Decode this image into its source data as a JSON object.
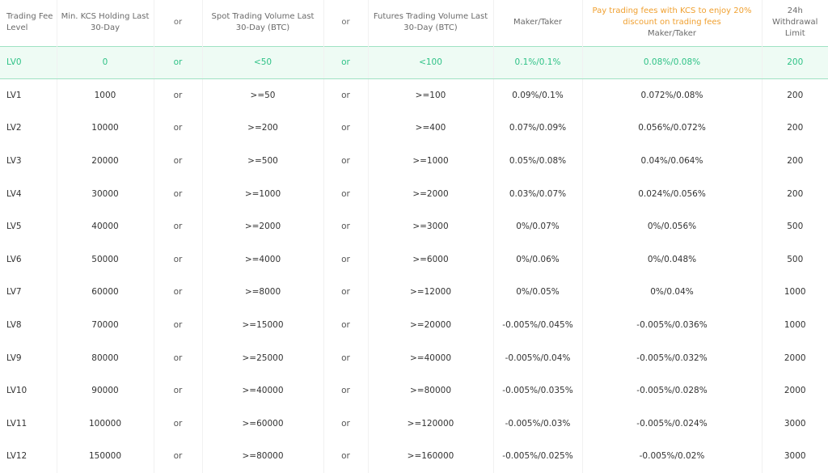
{
  "headers": {
    "level": "Trading Fee Level",
    "kcs_holding": "Min. KCS Holding Last 30-Day",
    "or1": "or",
    "spot_volume": "Spot Trading Volume Last 30-Day (BTC)",
    "or2": "or",
    "futures_volume": "Futures Trading Volume Last 30-Day (BTC)",
    "maker_taker": "Maker/Taker",
    "kcs_promo": "Pay trading fees with KCS to enjoy 20% discount on trading fees",
    "kcs_maker_taker": "Maker/Taker",
    "withdrawal": "24h Withdrawal Limit"
  },
  "rows": [
    {
      "level": "LV0",
      "kcs": "0",
      "or1": "or",
      "spot": "<50",
      "or2": "or",
      "futures": "<100",
      "fee": "0.1%/0.1%",
      "kcs_fee": "0.08%/0.08%",
      "limit": "200"
    },
    {
      "level": "LV1",
      "kcs": "1000",
      "or1": "or",
      "spot": ">=50",
      "or2": "or",
      "futures": ">=100",
      "fee": "0.09%/0.1%",
      "kcs_fee": "0.072%/0.08%",
      "limit": "200"
    },
    {
      "level": "LV2",
      "kcs": "10000",
      "or1": "or",
      "spot": ">=200",
      "or2": "or",
      "futures": ">=400",
      "fee": "0.07%/0.09%",
      "kcs_fee": "0.056%/0.072%",
      "limit": "200"
    },
    {
      "level": "LV3",
      "kcs": "20000",
      "or1": "or",
      "spot": ">=500",
      "or2": "or",
      "futures": ">=1000",
      "fee": "0.05%/0.08%",
      "kcs_fee": "0.04%/0.064%",
      "limit": "200"
    },
    {
      "level": "LV4",
      "kcs": "30000",
      "or1": "or",
      "spot": ">=1000",
      "or2": "or",
      "futures": ">=2000",
      "fee": "0.03%/0.07%",
      "kcs_fee": "0.024%/0.056%",
      "limit": "200"
    },
    {
      "level": "LV5",
      "kcs": "40000",
      "or1": "or",
      "spot": ">=2000",
      "or2": "or",
      "futures": ">=3000",
      "fee": "0%/0.07%",
      "kcs_fee": "0%/0.056%",
      "limit": "500"
    },
    {
      "level": "LV6",
      "kcs": "50000",
      "or1": "or",
      "spot": ">=4000",
      "or2": "or",
      "futures": ">=6000",
      "fee": "0%/0.06%",
      "kcs_fee": "0%/0.048%",
      "limit": "500"
    },
    {
      "level": "LV7",
      "kcs": "60000",
      "or1": "or",
      "spot": ">=8000",
      "or2": "or",
      "futures": ">=12000",
      "fee": "0%/0.05%",
      "kcs_fee": "0%/0.04%",
      "limit": "1000"
    },
    {
      "level": "LV8",
      "kcs": "70000",
      "or1": "or",
      "spot": ">=15000",
      "or2": "or",
      "futures": ">=20000",
      "fee": "-0.005%/0.045%",
      "kcs_fee": "-0.005%/0.036%",
      "limit": "1000"
    },
    {
      "level": "LV9",
      "kcs": "80000",
      "or1": "or",
      "spot": ">=25000",
      "or2": "or",
      "futures": ">=40000",
      "fee": "-0.005%/0.04%",
      "kcs_fee": "-0.005%/0.032%",
      "limit": "2000"
    },
    {
      "level": "LV10",
      "kcs": "90000",
      "or1": "or",
      "spot": ">=40000",
      "or2": "or",
      "futures": ">=80000",
      "fee": "-0.005%/0.035%",
      "kcs_fee": "-0.005%/0.028%",
      "limit": "2000"
    },
    {
      "level": "LV11",
      "kcs": "100000",
      "or1": "or",
      "spot": ">=60000",
      "or2": "or",
      "futures": ">=120000",
      "fee": "-0.005%/0.03%",
      "kcs_fee": "-0.005%/0.024%",
      "limit": "3000"
    },
    {
      "level": "LV12",
      "kcs": "150000",
      "or1": "or",
      "spot": ">=80000",
      "or2": "or",
      "futures": ">=160000",
      "fee": "-0.005%/0.025%",
      "kcs_fee": "-0.005%/0.02%",
      "limit": "3000"
    }
  ],
  "colors": {
    "current_level_text": "#2fc287",
    "current_level_bg": "#eefbf4",
    "promo_text": "#f0a030"
  }
}
